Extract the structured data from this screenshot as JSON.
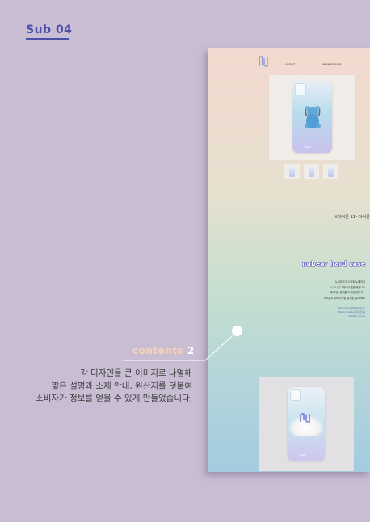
{
  "page_tag": "Sub 04",
  "nav": {
    "about": "ABOUT",
    "membership": "MEMBERSHIP"
  },
  "mockup": {
    "phone_brand": "nubear",
    "marquee": "※아이폰 11~아이폰",
    "product_title": "nubear hard case",
    "description_lines": [
      "누적코의 마스코트 누베어가",
      "시그니처 그라데이션을 배경으로",
      "캐리되는 깜찍한 디자인이랍니다.",
      "여러분도 누베어처럼 즐겨을 즐겨봐요!"
    ],
    "spec_lines": [
      "Polycarbonate Material",
      "Matte Coating(무광코팅)",
      "Made in Korea"
    ]
  },
  "contents_label": {
    "word": "contents",
    "number": "2"
  },
  "body_text_lines": [
    "각 디자인을 큰 이미지로 나열해",
    "짧은 설명과 소재 안내, 원산지를 덧붙여",
    "소비자가 정보를 얻을 수 있게 만들었습니다."
  ],
  "colors": {
    "accent": "#4a4fa8",
    "background": "#c9bdd4",
    "contents_word": "#f3d2b8"
  }
}
